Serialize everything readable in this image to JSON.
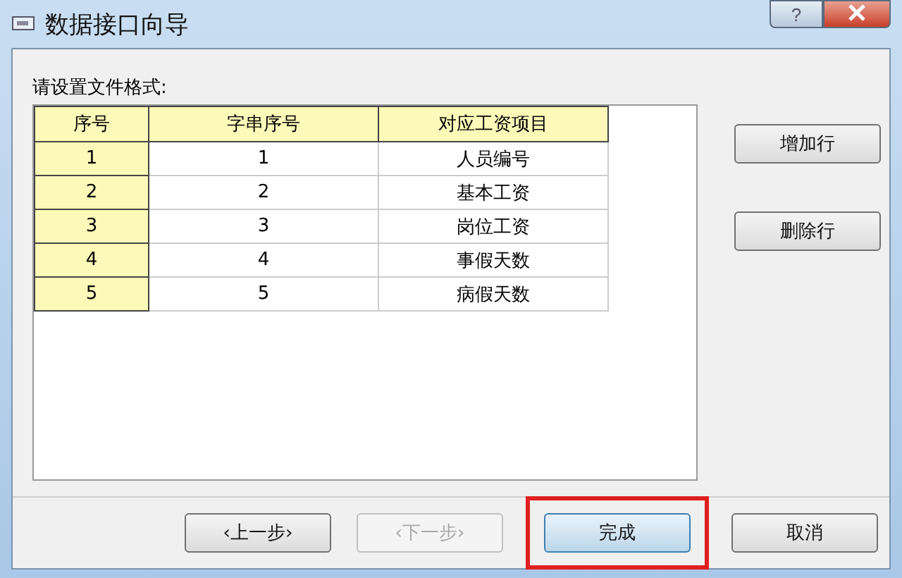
{
  "window": {
    "title": "数据接口向导",
    "help": "?"
  },
  "prompt": "请设置文件格式:",
  "table": {
    "columns": [
      "序号",
      "字串序号",
      "对应工资项目"
    ],
    "rows": [
      [
        "1",
        "1",
        "人员编号"
      ],
      [
        "2",
        "2",
        "基本工资"
      ],
      [
        "3",
        "3",
        "岗位工资"
      ],
      [
        "4",
        "4",
        "事假天数"
      ],
      [
        "5",
        "5",
        "病假天数"
      ]
    ]
  },
  "side_buttons": [
    "增加行",
    "删除行"
  ],
  "footer_buttons": [
    {
      "label": "‹上一步›",
      "disabled": false,
      "highlighted": false,
      "default": false
    },
    {
      "label": "‹下一步›",
      "disabled": true,
      "highlighted": false,
      "default": false
    },
    {
      "label": "完成",
      "disabled": false,
      "highlighted": true,
      "default": true
    },
    {
      "label": "取消",
      "disabled": false,
      "highlighted": false,
      "default": false
    }
  ]
}
